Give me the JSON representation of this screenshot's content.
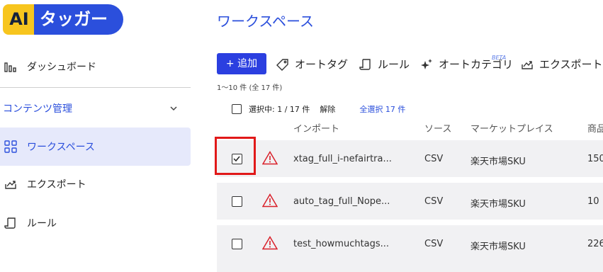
{
  "logo": {
    "ai": "AI",
    "name": "タッガー"
  },
  "sidebar": {
    "dashboard": "ダッシュボード",
    "section": "コンテンツ管理",
    "items": [
      {
        "label": "ワークスペース"
      },
      {
        "label": "エクスポート"
      },
      {
        "label": "ルール"
      }
    ]
  },
  "page": {
    "title": "ワークスペース"
  },
  "toolbar": {
    "add": "+ 追加",
    "auto_tag": "オートタグ",
    "rules": "ルール",
    "auto_category": "オートカテゴリ",
    "beta": "BETA",
    "export": "エクスポート"
  },
  "list": {
    "count": "1〜10 件 (全 17 件)",
    "selected": "選択中: 1 / 17 件",
    "clear": "解除",
    "select_all": "全選択 17 件",
    "headers": {
      "import": "インポート",
      "source": "ソース",
      "marketplace": "マーケットプレイス",
      "product": "商品"
    },
    "rows": [
      {
        "name": "xtag_full_i-nefairtra...",
        "source": "CSV",
        "marketplace": "楽天市場SKU",
        "count": "150",
        "checked": true
      },
      {
        "name": "auto_tag_full_Nope...",
        "source": "CSV",
        "marketplace": "楽天市場SKU",
        "count": "10",
        "checked": false
      },
      {
        "name": "test_howmuchtags...",
        "source": "CSV",
        "marketplace": "楽天市場SKU",
        "count": "226",
        "checked": false
      }
    ]
  },
  "colors": {
    "accent": "#2b4fdc",
    "button": "#2b3fe0",
    "highlight": "#e11919",
    "warning": "#d9202a"
  }
}
